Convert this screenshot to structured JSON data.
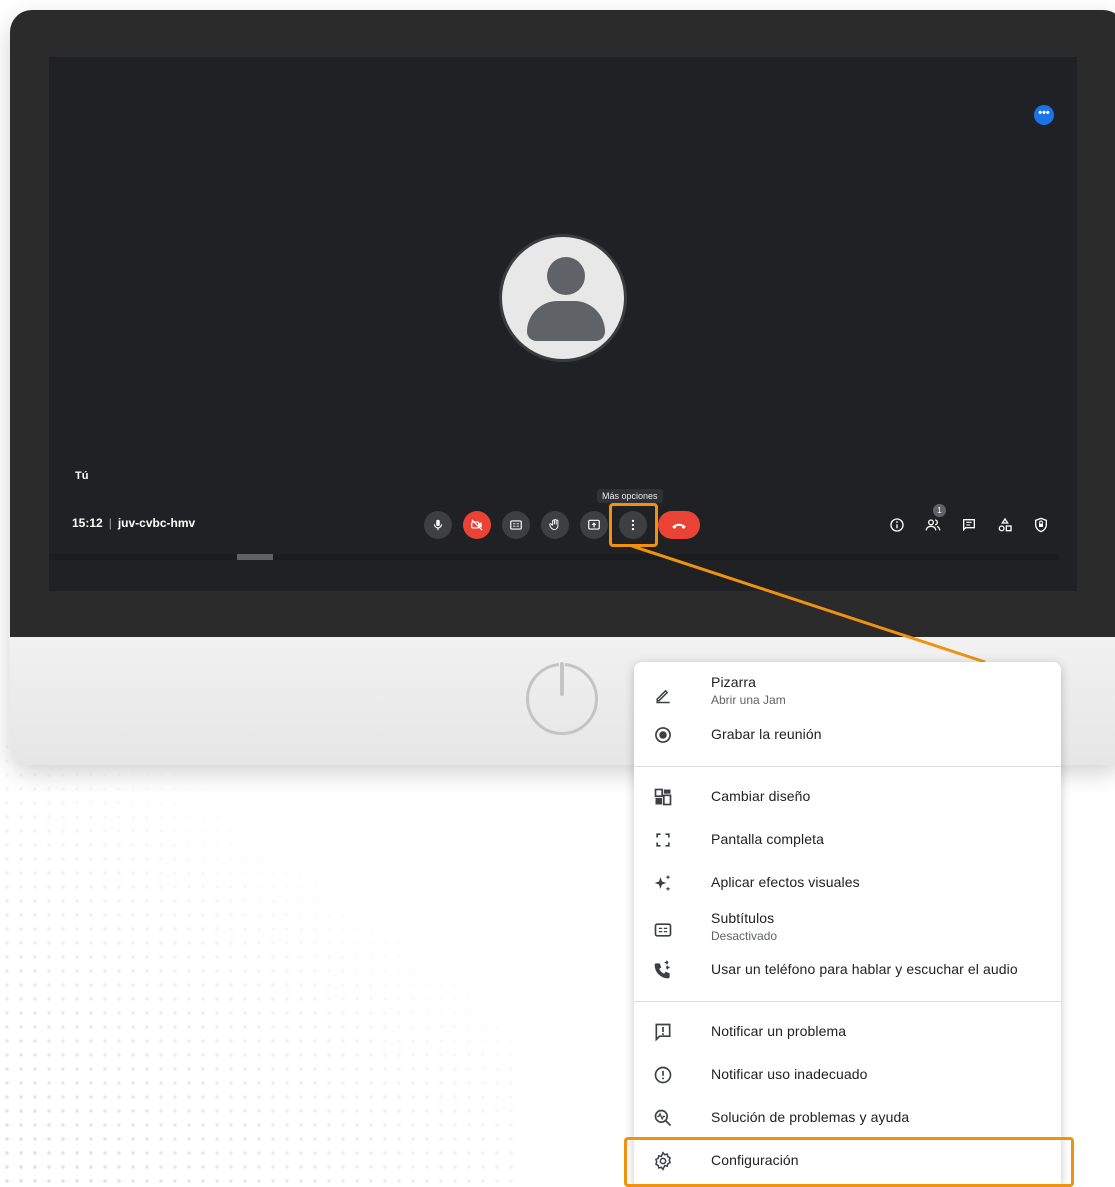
{
  "meeting": {
    "self_label": "Tú",
    "time": "15:12",
    "separator": "|",
    "code": "juv-cvbc-hmv",
    "more_badge": "•••",
    "tooltip": "Más opciones",
    "participants_count": "1"
  },
  "controls": [
    {
      "name": "mic-button",
      "icon": "mic-icon"
    },
    {
      "name": "camera-off-button",
      "icon": "videocam-off-icon"
    },
    {
      "name": "captions-button",
      "icon": "cc-icon"
    },
    {
      "name": "raise-hand-button",
      "icon": "hand-icon"
    },
    {
      "name": "present-button",
      "icon": "present-icon"
    },
    {
      "name": "more-options-button",
      "icon": "more-vert-icon"
    },
    {
      "name": "leave-call-button",
      "icon": "call-end-icon"
    }
  ],
  "right_controls": [
    "info-icon",
    "people-icon",
    "chat-icon",
    "activities-icon",
    "host-controls-icon"
  ],
  "colors": {
    "highlight": "#f0920f",
    "danger": "#ea4335",
    "accent": "#1a73e8"
  },
  "menu": {
    "items": [
      {
        "label": "Pizarra",
        "sub": "Abrir una Jam",
        "icon": "pencil-icon"
      },
      {
        "label": "Grabar la reunión",
        "icon": "record-icon"
      },
      {
        "label": "Cambiar diseño",
        "icon": "layout-icon"
      },
      {
        "label": "Pantalla completa",
        "icon": "fullscreen-icon"
      },
      {
        "label": "Aplicar efectos visuales",
        "icon": "sparkle-icon"
      },
      {
        "label": "Subtítulos",
        "sub": "Desactivado",
        "icon": "cc-icon"
      },
      {
        "label": "Usar un teléfono para hablar y escuchar el audio",
        "icon": "phone-forward-icon"
      },
      {
        "label": "Notificar un problema",
        "icon": "feedback-icon"
      },
      {
        "label": "Notificar uso inadecuado",
        "icon": "report-icon"
      },
      {
        "label": "Solución de problemas y ayuda",
        "icon": "troubleshoot-icon"
      },
      {
        "label": "Configuración",
        "icon": "settings-icon"
      }
    ]
  }
}
